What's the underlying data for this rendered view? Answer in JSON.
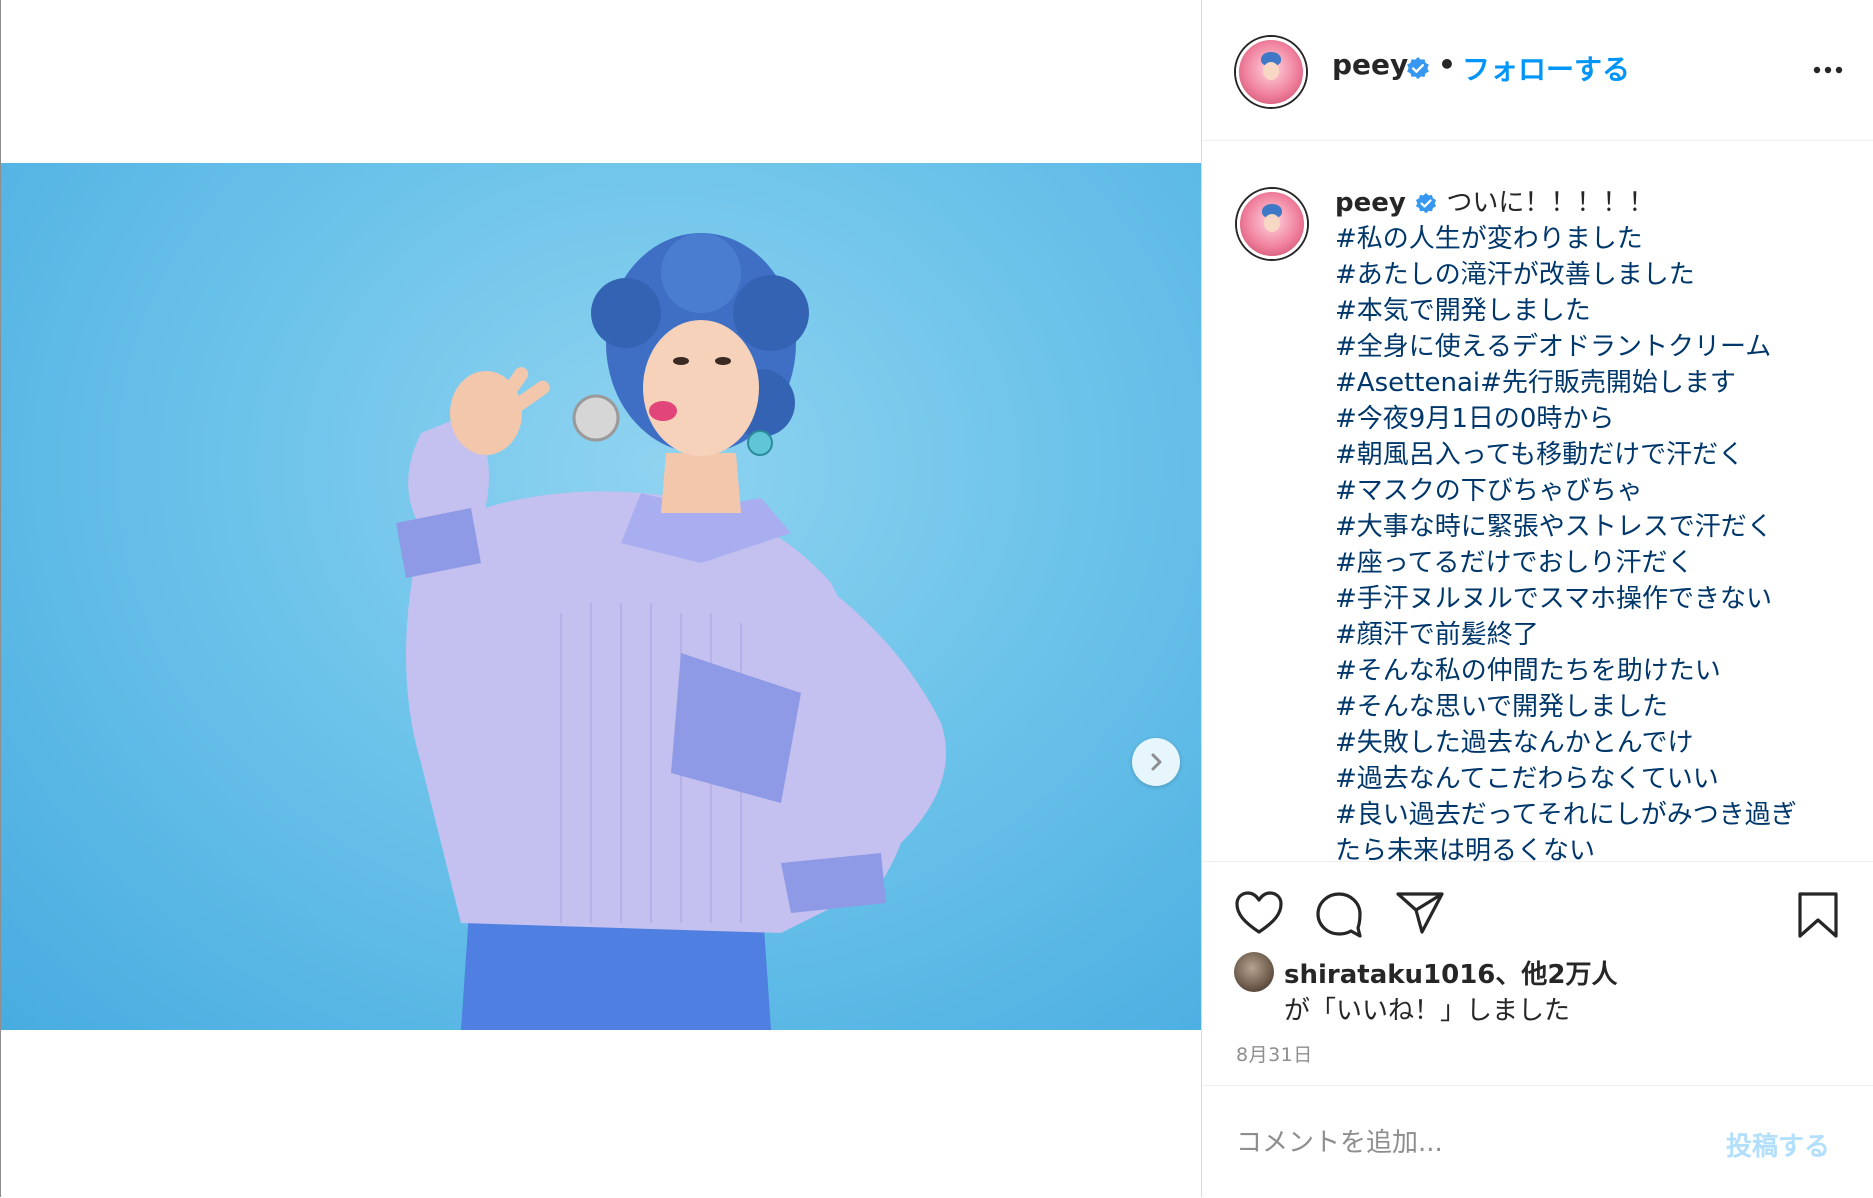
{
  "post": {
    "username": "peey",
    "follow_label": "フォローする",
    "separator": "•",
    "caption_username": "peey",
    "caption_first": "ついに！！！！！",
    "hashtags": [
      "#私の人生が変わりました",
      "#あたしの滝汗が改善しました",
      "#本気で開発しました",
      "#全身に使えるデオドラントクリーム",
      "#Asettenai#先行販売開始します",
      "#今夜9月1日の0時から",
      "#朝風呂入っても移動だけで汗だく",
      "#マスクの下びちゃびちゃ",
      "#大事な時に緊張やストレスで汗だく",
      "#座ってるだけでおしり汗だく",
      "#手汗ヌルヌルでスマホ操作できない",
      "#顔汗で前髪終了",
      "#そんな私の仲間たちを助けたい",
      "#そんな思いで開発しました",
      "#失敗した過去なんかとんでけ",
      "#過去なんてこだわらなくていい",
      "#良い過去だってそれにしがみつき過ぎ",
      "たら未来は明るくない"
    ],
    "likes_line1": "shirataku1016、他2万人",
    "likes_line2": "が「いいね！」しました",
    "date": "8月31日",
    "comment_placeholder": "コメントを追加...",
    "post_button": "投稿する"
  },
  "icons": {
    "verified": "verified-badge-icon",
    "more": "more-options-icon",
    "like": "heart-icon",
    "comment": "comment-icon",
    "share": "paper-plane-icon",
    "save": "bookmark-icon",
    "next": "chevron-right-icon"
  },
  "colors": {
    "accent": "#0095f6",
    "hashtag": "#00376b",
    "photo_background": "#6cc3ea",
    "post_disabled": "#b2dffc"
  }
}
